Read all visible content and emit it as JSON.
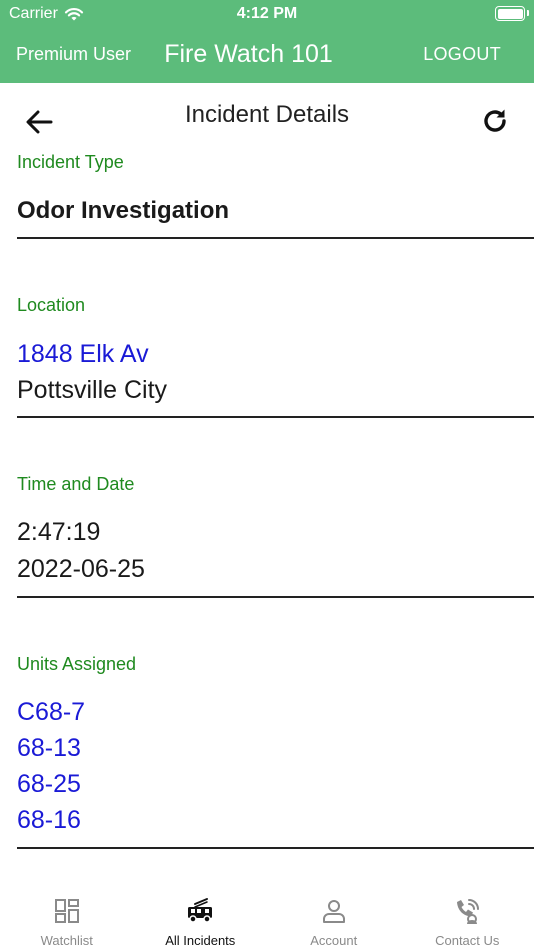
{
  "status_bar": {
    "carrier": "Carrier",
    "time": "4:12 PM"
  },
  "nav": {
    "user_label": "Premium User",
    "title": "Fire Watch 101",
    "logout_label": "LOGOUT"
  },
  "page": {
    "title": "Incident Details"
  },
  "incident": {
    "type_label": "Incident Type",
    "type_value": "Odor Investigation",
    "location_label": "Location",
    "address": "1848 Elk Av",
    "city": "Pottsville City",
    "time_label": "Time and Date",
    "time": "2:47:19",
    "date": "2022-06-25",
    "units_label": "Units Assigned",
    "units": [
      "C68-7",
      "68-13",
      "68-25",
      "68-16"
    ]
  },
  "tabs": [
    {
      "label": "Watchlist",
      "icon": "grid-icon",
      "active": false
    },
    {
      "label": "All Incidents",
      "icon": "fire-truck-icon",
      "active": true
    },
    {
      "label": "Account",
      "icon": "person-icon",
      "active": false
    },
    {
      "label": "Contact Us",
      "icon": "contact-icon",
      "active": false
    }
  ],
  "colors": {
    "header": "#5cbc7b",
    "label_green": "#1f8a1f",
    "link_blue": "#1a1ad6"
  }
}
